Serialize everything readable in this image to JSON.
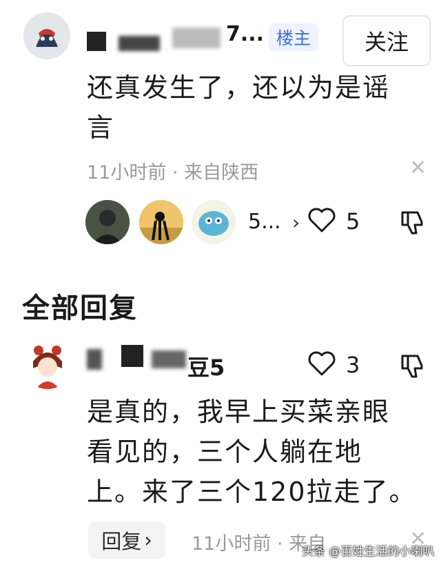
{
  "op_comment": {
    "username": "7...",
    "op_badge": "楼主",
    "follow_label": "关注",
    "text_line1": "还真发生了，还以为是谣",
    "text_line2": "言",
    "meta": "11小时前 · 来自陕西",
    "close_glyph": "✕",
    "like_avatars_count": "5...",
    "like_count": "5"
  },
  "section_title": "全部回复",
  "reply": {
    "username": "豆5",
    "like_count": "3",
    "text_line1": "是真的，我早上买菜亲眼",
    "text_line2": "看见的，三个人躺在地",
    "text_line3": "上。来了三个120拉走了。",
    "reply_label": "回复",
    "meta": "11小时前 · 来自",
    "close_glyph": "✕"
  },
  "watermark": "头条 @百姓生活的小喇叭",
  "colors": {
    "accent_blue": "#3d6fd8",
    "badge_bg": "#eef3ff",
    "muted": "#9a9a9a"
  }
}
